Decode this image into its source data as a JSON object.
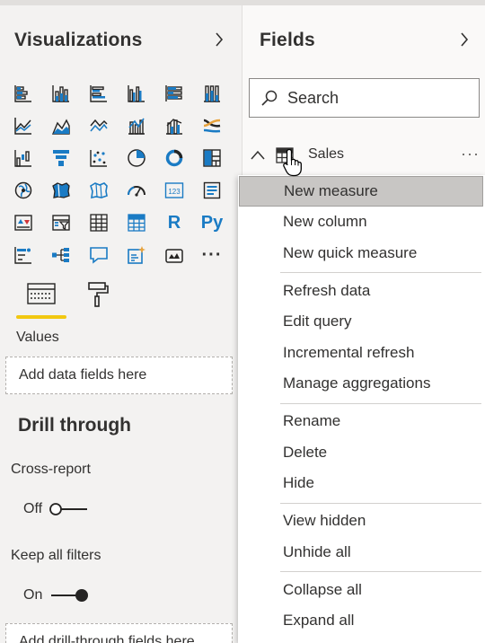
{
  "visualizations": {
    "title": "Visualizations",
    "icons": [
      "stacked-bar-chart-icon",
      "stacked-column-chart-icon",
      "clustered-bar-chart-icon",
      "clustered-column-chart-icon",
      "100-stacked-bar-chart-icon",
      "100-stacked-column-chart-icon",
      "line-chart-icon",
      "area-chart-icon",
      "stacked-area-chart-icon",
      "line-and-stacked-column-chart-icon",
      "line-and-clustered-column-chart-icon",
      "ribbon-chart-icon",
      "waterfall-chart-icon",
      "funnel-icon",
      "scatter-chart-icon",
      "pie-chart-icon",
      "donut-chart-icon",
      "treemap-icon",
      "map-icon",
      "filled-map-icon",
      "shape-map-icon",
      "gauge-icon",
      "card-icon",
      "multi-row-card-icon",
      "kpi-icon",
      "slicer-icon",
      "table-icon",
      "matrix-icon",
      "r-script-visual-icon",
      "python-visual-icon",
      "key-influencers-icon",
      "decomposition-tree-icon",
      "qa-icon",
      "smart-narrative-icon",
      "paginated-report-icon",
      "more-visuals-icon"
    ],
    "r_label": "R",
    "py_label": "Py",
    "more_label": "···",
    "values_label": "Values",
    "values_placeholder": "Add data fields here",
    "drill_through": {
      "title": "Drill through",
      "cross_report_label": "Cross-report",
      "cross_report_state": "Off",
      "keep_filters_label": "Keep all filters",
      "keep_filters_state": "On",
      "placeholder": "Add drill-through fields here"
    }
  },
  "fields": {
    "title": "Fields",
    "search_placeholder": "Search",
    "table_name": "Sales",
    "more_label": "···"
  },
  "context_menu": {
    "items": [
      {
        "label": "New measure",
        "highlighted": true
      },
      {
        "label": "New column"
      },
      {
        "label": "New quick measure"
      },
      {
        "label": "Refresh data"
      },
      {
        "label": "Edit query"
      },
      {
        "label": "Incremental refresh"
      },
      {
        "label": "Manage aggregations"
      },
      {
        "label": "Rename"
      },
      {
        "label": "Delete"
      },
      {
        "label": "Hide"
      },
      {
        "label": "View hidden"
      },
      {
        "label": "Unhide all"
      },
      {
        "label": "Collapse all"
      },
      {
        "label": "Expand all"
      }
    ]
  },
  "colors": {
    "accent_yellow": "#f2c811",
    "icon_blue": "#1a7bc4",
    "icon_dark": "#252423",
    "highlight": "#c8c6c4"
  }
}
